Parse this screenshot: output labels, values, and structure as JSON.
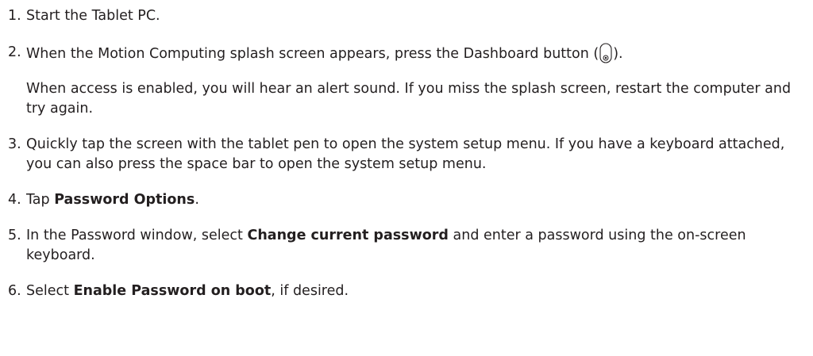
{
  "steps": [
    {
      "number": "1.",
      "text": "Start the Tablet PC."
    },
    {
      "number": "2.",
      "text_before": "When the Motion Computing splash screen appears, press the Dashboard button (",
      "icon": "dashboard-button-icon",
      "text_after": ").",
      "note": "When access is enabled, you will hear an alert sound. If you miss the splash screen, restart the computer and try again."
    },
    {
      "number": "3.",
      "text": "Quickly tap the screen with the tablet pen to open the system setup menu. If you have a keyboard attached, you can also press the space bar to open the system setup menu."
    },
    {
      "number": "4.",
      "text_before": "Tap ",
      "bold": "Password Options",
      "text_after": "."
    },
    {
      "number": "5.",
      "text_before": "In the Password window, select ",
      "bold": "Change current password",
      "text_after": " and enter a password using the on-screen keyboard."
    },
    {
      "number": "6.",
      "text_before": "Select ",
      "bold": "Enable Password on boot",
      "text_after": ", if desired."
    }
  ]
}
